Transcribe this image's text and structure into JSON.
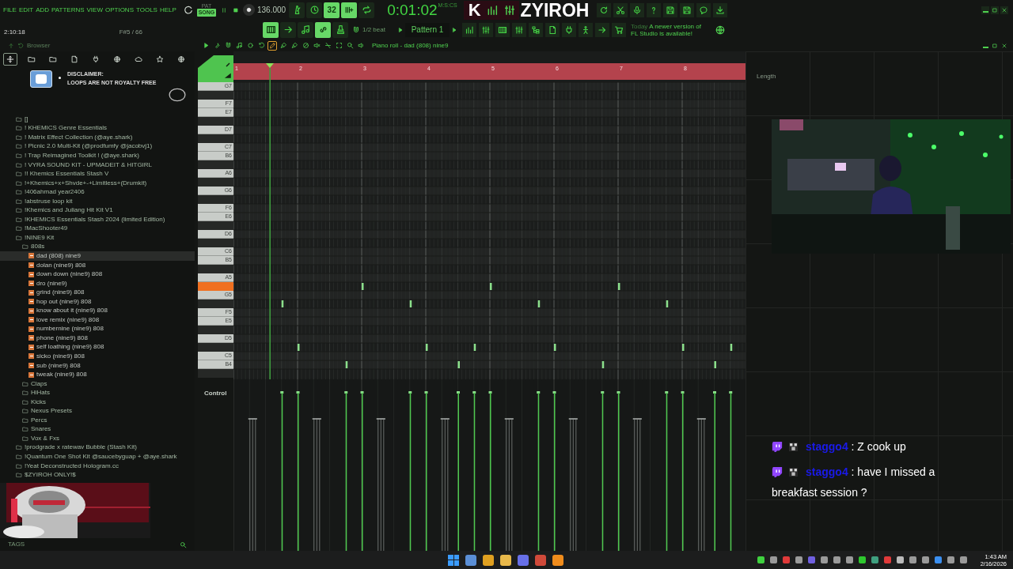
{
  "menu": [
    "FILE",
    "EDIT",
    "ADD",
    "PATTERNS",
    "VIEW",
    "OPTIONS",
    "TOOLS",
    "HELP"
  ],
  "transport": {
    "mode_small": "PAT",
    "mode": "SONG",
    "song_mode": true,
    "tempo": "136.000"
  },
  "toolbar_top": [
    {
      "on": false
    },
    {
      "on": false
    },
    {
      "label": "32",
      "on": true
    },
    {
      "on": true
    },
    {
      "on": false
    }
  ],
  "time": {
    "value": "0:01:02",
    "unit": "M:S:CS"
  },
  "brand": {
    "logo_letter": "K",
    "name": "ZYIROH"
  },
  "hint": {
    "position": "2:10:18",
    "note": "F#5 / 66"
  },
  "toolbar_edit": [
    {
      "on": true
    },
    {
      "on": false
    },
    {
      "on": false
    },
    {
      "on": true
    },
    {
      "on": false
    }
  ],
  "snap": "1/2 beat",
  "pattern": "Pattern 1",
  "news": {
    "date": "Today",
    "text": "A newer version of FL Studio is available!"
  },
  "browser": {
    "title": "Browser",
    "tabs": [
      {
        "selected": true
      },
      {
        "selected": false
      },
      {
        "selected": false
      },
      {
        "selected": false
      },
      {
        "selected": false
      },
      {
        "selected": false
      },
      {
        "selected": false
      },
      {
        "selected": false
      },
      {
        "selected": false
      }
    ],
    "disclaimer": {
      "title": "DISCLAIMER:",
      "text": "LOOPS ARE NOT ROYALTY FREE"
    },
    "tree": [
      {
        "label": "[]",
        "kind": "folder",
        "selected": false
      },
      {
        "label": "! KHEMICS Genre Essentials",
        "kind": "folder",
        "selected": false
      },
      {
        "label": "! Matrix Effect Collection (@aye.shark)",
        "kind": "folder",
        "selected": false
      },
      {
        "label": "! Picnic 2.0 Multi-Kit (@prodfumfy @jacobvj1)",
        "kind": "folder",
        "selected": false
      },
      {
        "label": "! Trap Reimagined Toolkit ! (@aye.shark)",
        "kind": "folder",
        "selected": false
      },
      {
        "label": "! VYRA SOUND KIT - UPMADEIT & HITGIRL",
        "kind": "folder",
        "selected": false
      },
      {
        "label": "!! Khemics Essentials Stash V",
        "kind": "folder",
        "selected": false
      },
      {
        "label": "!+Khemics+x+Shvde+-+Limitless+(Drumkit)",
        "kind": "folder",
        "selected": false
      },
      {
        "label": "!406ahmad year2406",
        "kind": "folder",
        "selected": false
      },
      {
        "label": "!abstruse loop kit",
        "kind": "folder",
        "selected": false
      },
      {
        "label": "!Khemics and Juliang Hit Kit V1",
        "kind": "folder",
        "selected": false
      },
      {
        "label": "!KHEMICS Essentials Stash 2024 (limited Edition)",
        "kind": "folder",
        "selected": false
      },
      {
        "label": "!MacShooter49",
        "kind": "folder",
        "selected": false
      },
      {
        "label": "!NINE9 Kit",
        "kind": "folder",
        "selected": false,
        "children": [
          {
            "label": "808s",
            "kind": "folder",
            "selected": false,
            "children": [
              {
                "label": "dad (808) nine9",
                "kind": "file",
                "selected": true
              },
              {
                "label": "dolan (nine9) 808",
                "kind": "file",
                "selected": false
              },
              {
                "label": "down down (nine9) 808",
                "kind": "file",
                "selected": false
              },
              {
                "label": "dro (nine9)",
                "kind": "file",
                "selected": false
              },
              {
                "label": "grind (nine9) 808",
                "kind": "file",
                "selected": false
              },
              {
                "label": "hop out (nine9) 808",
                "kind": "file",
                "selected": false
              },
              {
                "label": "know about it (nine9) 808",
                "kind": "file",
                "selected": false
              },
              {
                "label": "love remix (nine9) 808",
                "kind": "file",
                "selected": false
              },
              {
                "label": "numbernine (nine9) 808",
                "kind": "file",
                "selected": false
              },
              {
                "label": "phone (nine9) 808",
                "kind": "file",
                "selected": false
              },
              {
                "label": "self loathing (nine9) 808",
                "kind": "file",
                "selected": false
              },
              {
                "label": "sicko (nine9) 808",
                "kind": "file",
                "selected": false
              },
              {
                "label": "sub (nine9) 808",
                "kind": "file",
                "selected": false
              },
              {
                "label": "tweak (nine9) 808",
                "kind": "file",
                "selected": false
              }
            ]
          },
          {
            "label": "Claps",
            "kind": "folder",
            "selected": false
          },
          {
            "label": "HiHats",
            "kind": "folder",
            "selected": false
          },
          {
            "label": "Kicks",
            "kind": "folder",
            "selected": false
          },
          {
            "label": "Nexus Presets",
            "kind": "folder",
            "selected": false
          },
          {
            "label": "Percs",
            "kind": "folder",
            "selected": false
          },
          {
            "label": "Snares",
            "kind": "folder",
            "selected": false
          },
          {
            "label": "Vox & Fxs",
            "kind": "folder",
            "selected": false
          }
        ]
      },
      {
        "label": "!prodgrade x ratewav Bubble (Stash Kit)",
        "kind": "folder",
        "selected": false
      },
      {
        "label": "!Quantum One Shot Kit @saucebyguap + @aye.shark",
        "kind": "folder",
        "selected": false
      },
      {
        "label": "!Yeat Deconstructed Hologram.cc",
        "kind": "folder",
        "selected": false
      },
      {
        "label": "$ZYIROH ONLY!$",
        "kind": "folder",
        "selected": false
      }
    ],
    "footer": "TAGS"
  },
  "piano_roll": {
    "title": "Piano roll - dad (808) nine9",
    "tools": [
      {
        "selected": false
      },
      {
        "selected": false
      },
      {
        "selected": false
      },
      {
        "selected": false
      },
      {
        "selected": false
      },
      {
        "selected": false
      },
      {
        "selected": true
      },
      {
        "selected": false
      },
      {
        "selected": false
      },
      {
        "selected": false
      },
      {
        "selected": false
      },
      {
        "selected": false
      },
      {
        "selected": false
      },
      {
        "selected": false
      },
      {
        "selected": false
      }
    ],
    "bars": [
      "1",
      "2",
      "3",
      "4",
      "5",
      "6",
      "7",
      "8"
    ],
    "length_label": "Length",
    "playhead": {
      "level": 0.071
    },
    "keys": [
      {
        "note": "G7",
        "kind": "white",
        "highlighted": false
      },
      {
        "kind": "black",
        "highlighted": false
      },
      {
        "note": "F7",
        "kind": "white",
        "highlighted": false
      },
      {
        "note": "E7",
        "kind": "white",
        "highlighted": false
      },
      {
        "kind": "black",
        "highlighted": false
      },
      {
        "note": "D7",
        "kind": "white",
        "highlighted": false
      },
      {
        "kind": "black",
        "highlighted": false
      },
      {
        "note": "C7",
        "kind": "white",
        "highlighted": false
      },
      {
        "note": "B6",
        "kind": "white",
        "highlighted": false
      },
      {
        "kind": "black",
        "highlighted": false
      },
      {
        "note": "A6",
        "kind": "white",
        "highlighted": false
      },
      {
        "kind": "black",
        "highlighted": false
      },
      {
        "note": "G6",
        "kind": "white",
        "highlighted": false
      },
      {
        "kind": "black",
        "highlighted": false
      },
      {
        "note": "F6",
        "kind": "white",
        "highlighted": false
      },
      {
        "note": "E6",
        "kind": "white",
        "highlighted": false
      },
      {
        "kind": "black",
        "highlighted": false
      },
      {
        "note": "D6",
        "kind": "white",
        "highlighted": false
      },
      {
        "kind": "black",
        "highlighted": false
      },
      {
        "note": "C6",
        "kind": "white",
        "highlighted": false
      },
      {
        "note": "B5",
        "kind": "white",
        "highlighted": false
      },
      {
        "kind": "black",
        "highlighted": false
      },
      {
        "note": "A5",
        "kind": "white",
        "highlighted": false
      },
      {
        "kind": "black",
        "highlighted": true
      },
      {
        "note": "G5",
        "kind": "white",
        "highlighted": false
      },
      {
        "kind": "black",
        "highlighted": false
      },
      {
        "note": "F5",
        "kind": "white",
        "highlighted": false
      },
      {
        "note": "E5",
        "kind": "white",
        "highlighted": false
      },
      {
        "kind": "black",
        "highlighted": false
      },
      {
        "note": "D5",
        "kind": "white",
        "highlighted": false
      },
      {
        "kind": "black",
        "highlighted": false
      },
      {
        "note": "C5",
        "kind": "white",
        "highlighted": false
      },
      {
        "note": "B4",
        "kind": "white",
        "highlighted": false
      },
      {
        "kind": "black",
        "highlighted": false
      }
    ],
    "lane_label": "Control"
  },
  "webcam": {
    "kind": "picture"
  },
  "chat": [
    {
      "user": "staggo4",
      "text": ": Z cook up"
    },
    {
      "user": "staggo4",
      "text": ": have I missed a breakfast session ?"
    }
  ],
  "taskbar": {
    "apps": [
      {
        "kind": "start",
        "color": "#3b9cff"
      },
      {
        "kind": "app",
        "color": "#5b8fd6"
      },
      {
        "kind": "app",
        "color": "#e0a020"
      },
      {
        "kind": "app",
        "color": "#e8b84a"
      },
      {
        "kind": "app",
        "color": "#6870e8"
      },
      {
        "kind": "app",
        "color": "#d04a3a"
      },
      {
        "kind": "app",
        "color": "#f08c1c"
      }
    ],
    "tray": [
      {
        "color": "#3fd13f"
      },
      {
        "color": "#9a9a9a"
      },
      {
        "color": "#e03a3a"
      },
      {
        "color": "#9a9a9a"
      },
      {
        "color": "#7060e0"
      },
      {
        "color": "#9a9a9a"
      },
      {
        "color": "#9a9a9a"
      },
      {
        "color": "#9a9a9a"
      },
      {
        "color": "#2ec82e"
      },
      {
        "color": "#3f9f7f"
      },
      {
        "color": "#e03a3a"
      },
      {
        "color": "#bbbbbb"
      },
      {
        "color": "#9a9a9a"
      },
      {
        "color": "#9a9a9a"
      },
      {
        "color": "#3b8ff0"
      },
      {
        "color": "#9a9a9a"
      },
      {
        "color": "#9a9a9a"
      }
    ],
    "clock_time": "1:43 AM",
    "clock_date": "2/16/2026"
  }
}
